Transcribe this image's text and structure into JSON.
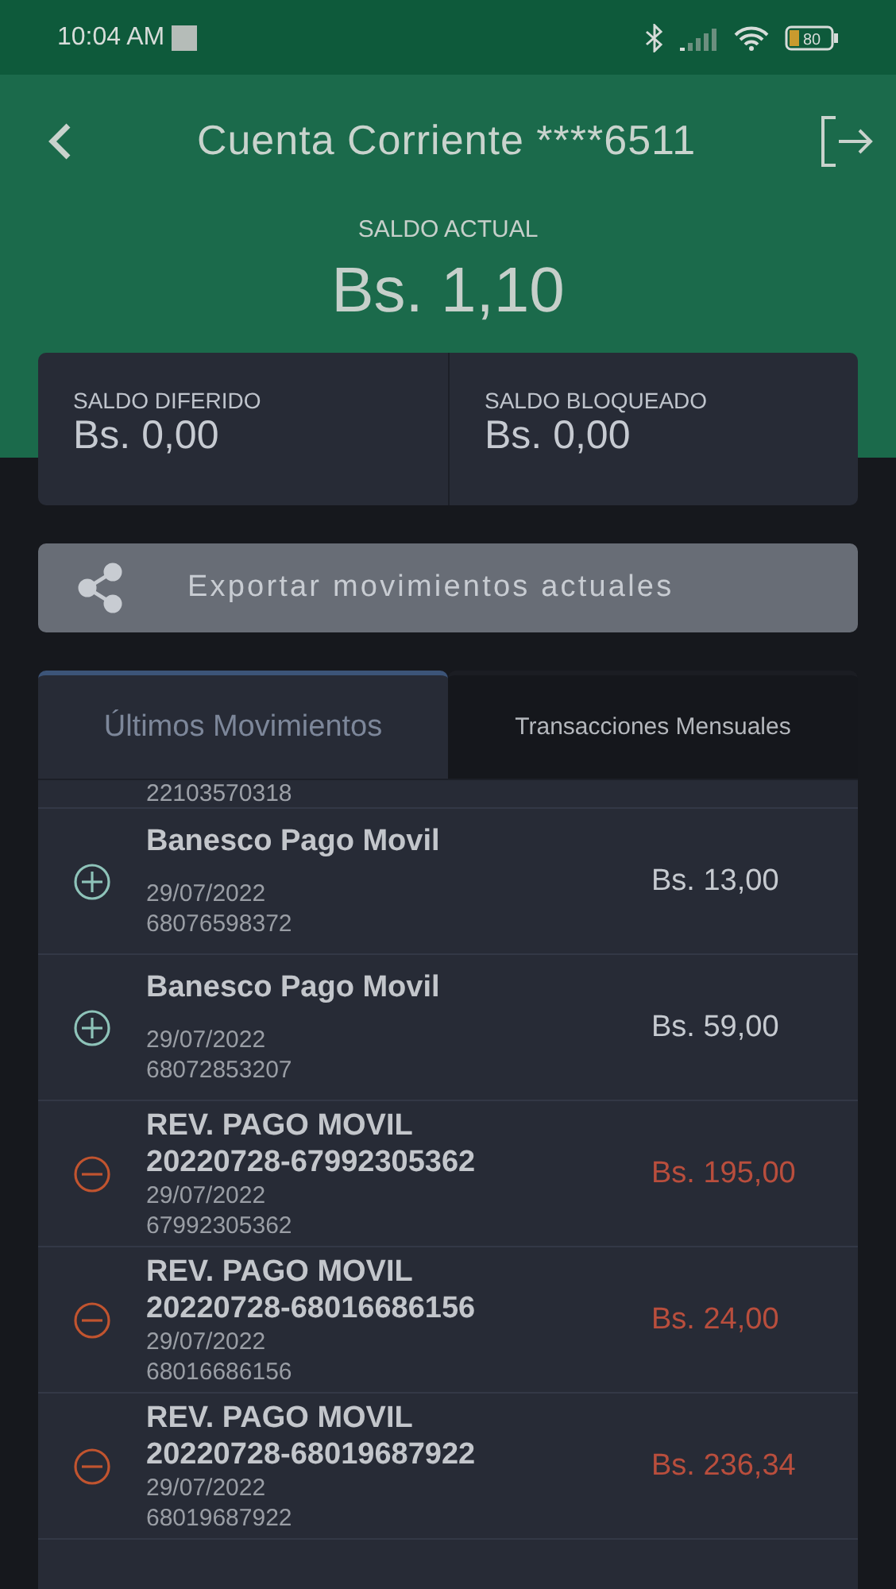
{
  "status_bar": {
    "time": "10:04 AM",
    "battery": "80"
  },
  "header": {
    "title": "Cuenta Corriente ****6511"
  },
  "balance": {
    "label": "SALDO ACTUAL",
    "amount": "Bs. 1,10"
  },
  "sub_balances": [
    {
      "label": "SALDO DIFERIDO",
      "amount": "Bs. 0,00"
    },
    {
      "label": "SALDO BLOQUEADO",
      "amount": "Bs. 0,00"
    }
  ],
  "export_button": {
    "label": "Exportar movimientos actuales"
  },
  "tabs": [
    {
      "label": "Últimos Movimientos",
      "selected": true
    },
    {
      "label": "Transacciones Mensuales",
      "selected": false
    }
  ],
  "partial_reference": "22103570318",
  "movements": [
    {
      "kind": "credit",
      "name": "Banesco Pago Movil",
      "date": "29/07/2022",
      "reference": "68076598372",
      "amount": "Bs. 13,00"
    },
    {
      "kind": "credit",
      "name": "Banesco Pago Movil",
      "date": "29/07/2022",
      "reference": "68072853207",
      "amount": "Bs. 59,00"
    },
    {
      "kind": "debit",
      "name": "REV. PAGO MOVIL 20220728-67992305362",
      "date": "29/07/2022",
      "reference": "67992305362",
      "amount": "Bs. 195,00"
    },
    {
      "kind": "debit",
      "name": "REV. PAGO MOVIL 20220728-68016686156",
      "date": "29/07/2022",
      "reference": "68016686156",
      "amount": "Bs. 24,00"
    },
    {
      "kind": "debit",
      "name": "REV. PAGO MOVIL 20220728-68019687922",
      "date": "29/07/2022",
      "reference": "68019687922",
      "amount": "Bs. 236,34"
    }
  ]
}
